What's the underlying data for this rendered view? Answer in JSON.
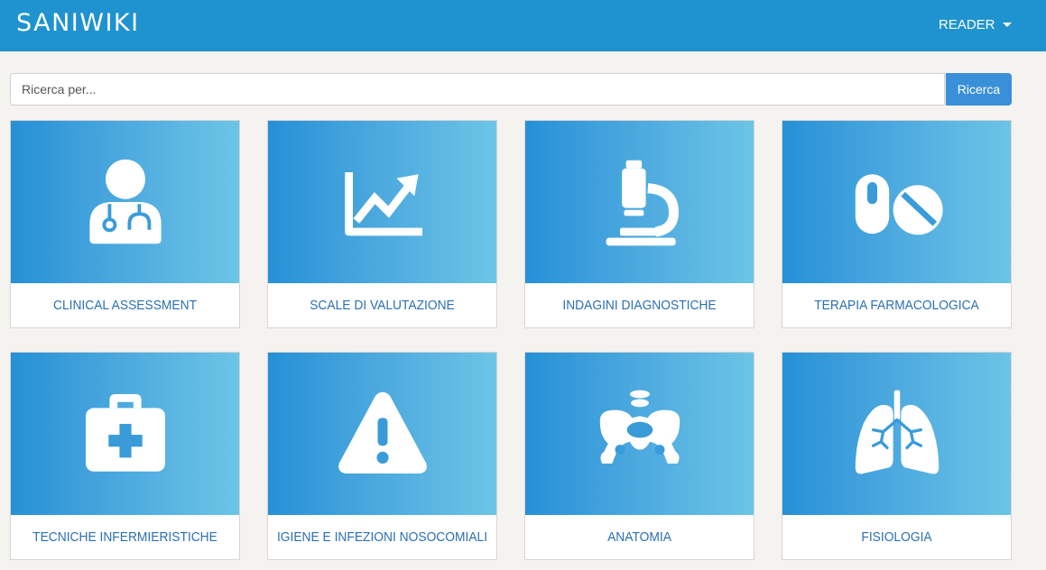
{
  "header": {
    "brand": "SANIWIKI",
    "user_menu_label": "READER"
  },
  "search": {
    "placeholder": "Ricerca per...",
    "value": "",
    "button_label": "Ricerca"
  },
  "colors": {
    "navbar": "#1f93cf",
    "accent_button": "#3a8fd9",
    "card_title": "#2a6fb5",
    "gradient_start": "#2690d6",
    "gradient_end": "#6cc5e6",
    "background": "#f4f3ef"
  },
  "categories": [
    {
      "title": "CLINICAL ASSESSMENT",
      "icon": "doctor-icon"
    },
    {
      "title": "SCALE DI VALUTAZIONE",
      "icon": "chart-line-icon"
    },
    {
      "title": "INDAGINI DIAGNOSTICHE",
      "icon": "microscope-icon"
    },
    {
      "title": "TERAPIA FARMACOLOGICA",
      "icon": "pills-icon"
    },
    {
      "title": "TECNICHE INFERMIERISTICHE",
      "icon": "first-aid-kit-icon"
    },
    {
      "title": "IGIENE E INFEZIONI NOSOCOMIALI",
      "icon": "warning-icon"
    },
    {
      "title": "ANATOMIA",
      "icon": "pelvis-bone-icon"
    },
    {
      "title": "FISIOLOGIA",
      "icon": "lungs-icon"
    }
  ]
}
